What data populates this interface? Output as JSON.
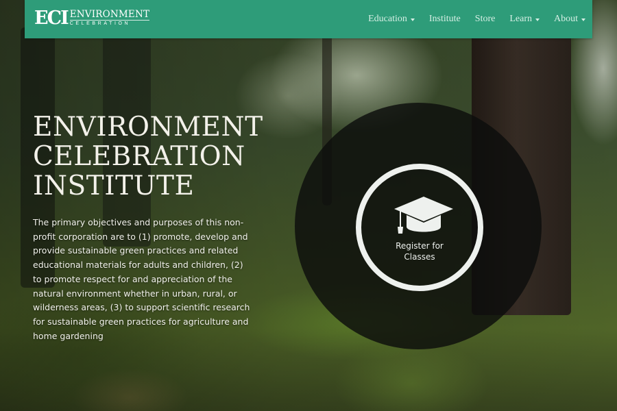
{
  "brand": {
    "mark": "ECI",
    "line1": "ENVIRONMENT",
    "line2": "CELEBRATION"
  },
  "nav": [
    {
      "label": "Education",
      "dropdown": true
    },
    {
      "label": "Institute",
      "dropdown": false
    },
    {
      "label": "Store",
      "dropdown": false
    },
    {
      "label": "Learn",
      "dropdown": true
    },
    {
      "label": "About",
      "dropdown": true
    }
  ],
  "hero": {
    "title_lines": [
      "ENVIRONMENT",
      "CELEBRATION",
      "INSTITUTE"
    ],
    "description": "The primary objectives and purposes of this non-profit corporation are to (1) promote, develop and provide sustainable green practices and related educational materials for adults and children, (2) to promote respect for and appreciation of the natural environment whether in urban, rural, or wilderness areas, (3) to support scientific research for sustainable green practices for agriculture and home gardening"
  },
  "cta": {
    "icon": "graduation-cap-icon",
    "label_line1": "Register for",
    "label_line2": "Classes"
  },
  "colors": {
    "nav_bg": "#2e9c79",
    "nav_text": "#d6efe5",
    "hero_text": "#f3f1ea",
    "cta_ring": "#eef1ee"
  }
}
